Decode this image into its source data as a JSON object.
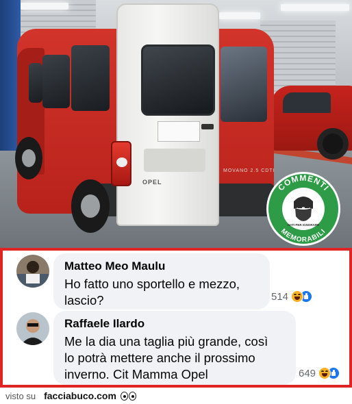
{
  "photo": {
    "subject": "red van with mismatched white rear door",
    "door_brand_text": "OPEL",
    "model_badge_text": "MOVANO 2.5 CDTI"
  },
  "badge": {
    "arc_top": "COMMENTI",
    "arc_bottom": "MEMORABILI",
    "inner_text": "NATI PER IGNORARE",
    "color": "#2e9b46",
    "icon": "bearded-man-icon"
  },
  "comments": [
    {
      "author": "Matteo Meo Maulu",
      "text_lines": [
        "Ho fatto uno sportello e mezzo,",
        "lascio?"
      ],
      "reaction_count": "514",
      "reaction_icons": [
        "haha-icon",
        "like-icon"
      ]
    },
    {
      "author": "Raffaele Ilardo",
      "text_lines": [
        "Me la dia una taglia più grande, così",
        "lo potrà mettere anche il prossimo",
        "inverno. Cit Mamma Opel"
      ],
      "reaction_count": "649",
      "reaction_icons": [
        "haha-icon",
        "like-icon"
      ]
    }
  ],
  "footer": {
    "visto_su": "visto su",
    "site": "facciabuco.com",
    "icon": "eyes-icon"
  },
  "colors": {
    "frame_red": "#e02424",
    "bubble_bg": "#f0f2f5",
    "like_blue": "#1877f2",
    "haha_yellow": "#f7b125"
  }
}
